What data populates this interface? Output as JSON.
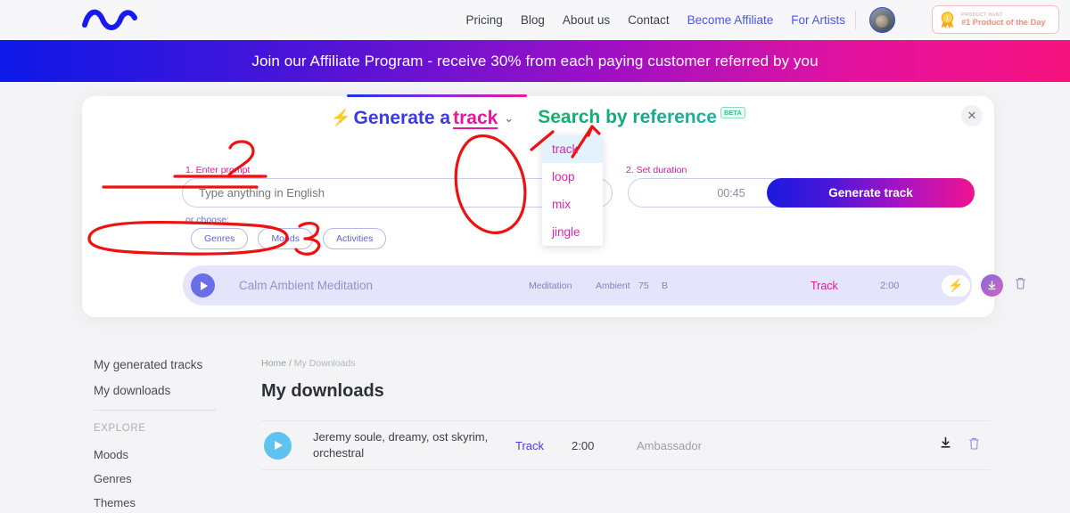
{
  "nav": {
    "logo_name": "wave-logo",
    "links": [
      {
        "label": "Pricing",
        "accent": false
      },
      {
        "label": "Blog",
        "accent": false
      },
      {
        "label": "About us",
        "accent": false
      },
      {
        "label": "Contact",
        "accent": false
      },
      {
        "label": "Become Affiliate",
        "accent": true
      },
      {
        "label": "For Artists",
        "accent": true
      }
    ],
    "product_hunt": {
      "top_label": "PRODUCT HUNT",
      "main_label": "#1 Product of the Day"
    }
  },
  "banner": {
    "text": "Join our Affiliate Program - receive 30% from each paying customer referred by you"
  },
  "card": {
    "close_label": "✕",
    "tabs": {
      "generate_prefix": "Generate a",
      "generate_kind": "track",
      "caret": "⌄",
      "search_label": "Search by reference",
      "beta_label": "BETA"
    },
    "dropdown": {
      "items": [
        "track",
        "loop",
        "mix",
        "jingle"
      ],
      "selected": "track"
    },
    "step1_label": "1. Enter prompt",
    "step2_label": "2. Set duration",
    "prompt_placeholder": "Type anything in English",
    "prompt_value": "",
    "or_choose_label": "or choose:",
    "chips": [
      "Genres",
      "Moods",
      "Activities"
    ],
    "duration_value": "00:45",
    "generate_button": "Generate track",
    "track": {
      "title": "Calm Ambient Meditation",
      "meta": [
        "Meditation",
        "Ambient",
        "75",
        "B"
      ],
      "kind": "Track",
      "duration": "2:00",
      "bolt_icon": "⚡",
      "download_icon": "download-icon",
      "delete_icon": "trash-icon"
    }
  },
  "sidebar": {
    "items": [
      "My generated tracks",
      "My downloads"
    ],
    "explore_label": "EXPLORE",
    "explore_items": [
      "Moods",
      "Genres",
      "Themes"
    ]
  },
  "content": {
    "breadcrumb_home": "Home",
    "breadcrumb_sep": "/",
    "breadcrumb_current": "My Downloads",
    "title": "My downloads",
    "downloads": [
      {
        "name": "Jeremy soule, dreamy, ost skyrim, orchestral",
        "kind": "Track",
        "duration": "2:00",
        "license": "Ambassador"
      }
    ]
  },
  "annotations": {
    "marks": [
      "2",
      "3"
    ],
    "accent_color": "#ee1111"
  }
}
